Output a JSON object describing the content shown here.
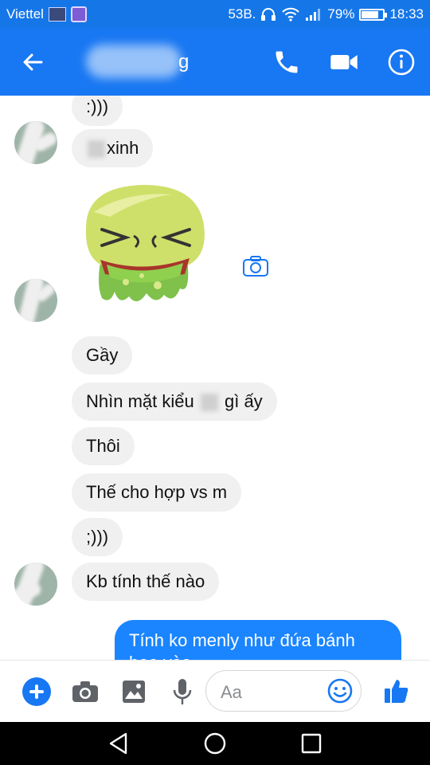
{
  "status_bar": {
    "carrier": "Viettel",
    "data_indicator": "53B.",
    "battery": "79%",
    "battery_level": 0.79,
    "time": "18:33"
  },
  "header": {
    "contact_name_visible": "g",
    "icons": [
      "back-arrow-icon",
      "phone-icon",
      "video-camera-icon",
      "info-icon"
    ]
  },
  "conversation": {
    "incoming": [
      {
        "text": ":)))"
      },
      {
        "text_before": "",
        "text_after": "xinh"
      },
      {
        "text": "Gầy"
      },
      {
        "text_before": "Nhìn mặt kiểu",
        "text_after": "gì ấy"
      },
      {
        "text": "Thôi"
      },
      {
        "text": "Thế cho hợp vs m"
      },
      {
        "text": ";)))"
      },
      {
        "text": "Kb tính thế nào"
      }
    ],
    "outgoing": [
      {
        "text": "Tính ko menly như đứa bánh bao vào..."
      }
    ],
    "sticker": "sick-face-sticker"
  },
  "composer": {
    "placeholder": "Aa",
    "value": "",
    "icons": [
      "add-icon",
      "camera-icon",
      "image-icon",
      "microphone-icon",
      "emoji-icon",
      "thumbs-up-icon"
    ]
  },
  "colors": {
    "accent": "#1877f2",
    "status_bar": "#1576e8",
    "incoming_bubble": "#f1f0f0",
    "outgoing_bubble": "#1a85ff"
  }
}
